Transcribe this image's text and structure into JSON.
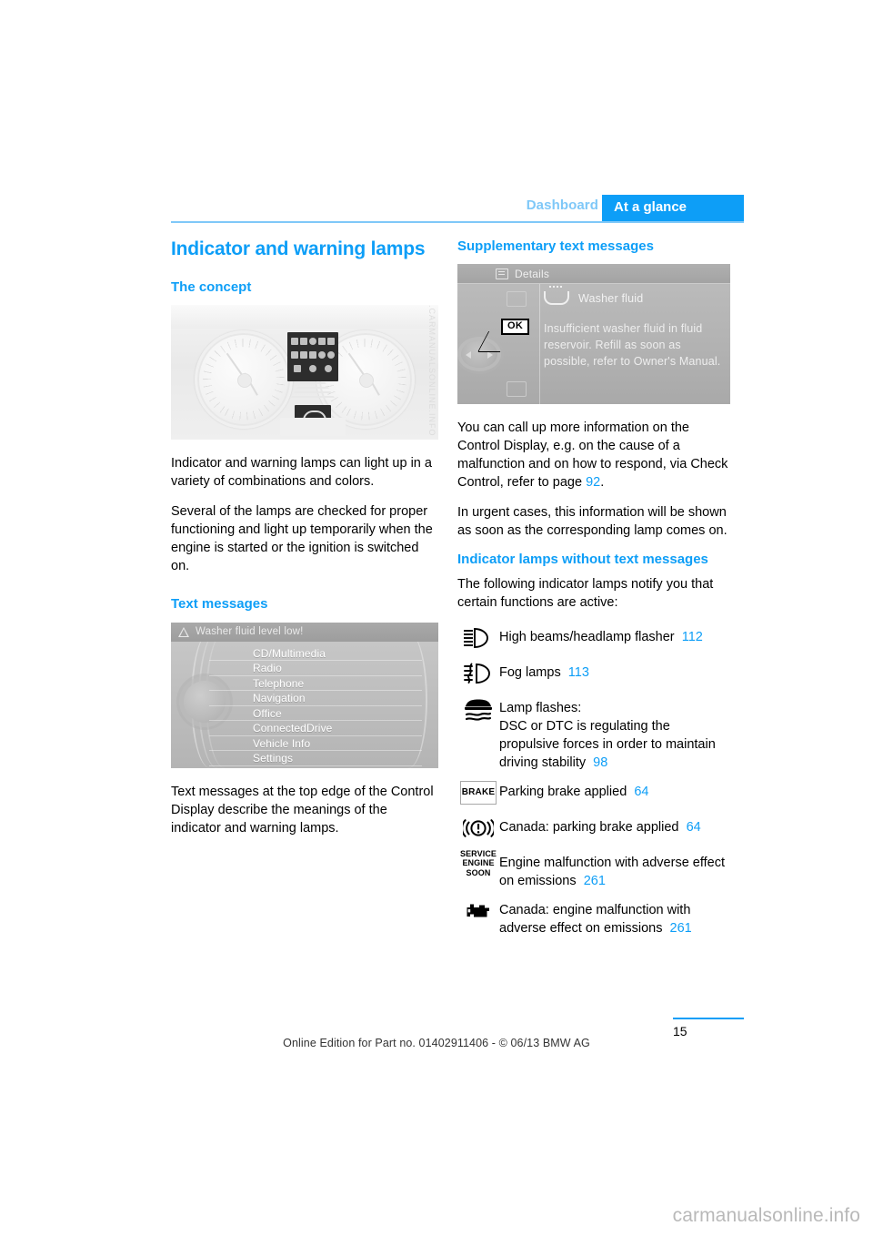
{
  "header": {
    "breadcrumb": "Dashboard",
    "tab": "At a glance",
    "accent_color": "#0d9ef7",
    "breadcrumb_color": "#7fc8f8"
  },
  "left_column": {
    "title": "Indicator and warning lamps",
    "concept": {
      "heading": "The concept",
      "figure": {
        "name": "instrument-cluster-photo",
        "watermark": "WWW.CARMANUALSONLINE.INFO"
      },
      "paragraphs": [
        "Indicator and warning lamps can light up in a variety of combinations and colors.",
        "Several of the lamps are checked for proper functioning and light up temporarily when the engine is started or the ignition is switched on."
      ]
    },
    "text_messages": {
      "heading": "Text messages",
      "figure": {
        "name": "idrive-main-menu",
        "status_bar": "Washer fluid level low!",
        "menu_items": [
          "CD/Multimedia",
          "Radio",
          "Telephone",
          "Navigation",
          "Office",
          "ConnectedDrive",
          "Vehicle Info",
          "Settings"
        ]
      },
      "paragraphs": [
        "Text messages at the top edge of the Control Display describe the meanings of the indicator and warning lamps."
      ]
    }
  },
  "right_column": {
    "supplementary": {
      "heading": "Supplementary text messages",
      "figure": {
        "name": "control-display-details",
        "title_bar": "Details",
        "ok_button": "OK",
        "item_title": "Washer fluid",
        "item_body": "Insufficient washer fluid in fluid reservoir. Refill as soon as possible, refer to Owner's Manual."
      },
      "paragraph_1_pre": "You can call up more information on the Control Display, e.g. on the cause of a malfunction and on how to respond, via Check Control, refer to page ",
      "paragraph_1_page": "92",
      "paragraph_1_post": ".",
      "paragraph_2": "In urgent cases, this information will be shown as soon as the corresponding lamp comes on."
    },
    "without_text": {
      "heading": "Indicator lamps without text messages",
      "intro": "The following indicator lamps notify you that certain functions are active:",
      "lamps": [
        {
          "icon": "high-beam-icon",
          "text": "High beams/headlamp flasher",
          "page": "112"
        },
        {
          "icon": "fog-lamp-icon",
          "text": "Fog lamps",
          "page": "113"
        },
        {
          "icon": "dsc-skid-icon",
          "text": "Lamp flashes:\nDSC or DTC is regulating the propulsive forces in order to maintain driving stability",
          "page": "98"
        },
        {
          "icon": "brake-text-icon",
          "icon_label": "BRAKE",
          "text": "Parking brake applied",
          "page": "64"
        },
        {
          "icon": "parking-brake-circle-icon",
          "text": "Canada: parking brake applied",
          "page": "64"
        },
        {
          "icon": "service-engine-soon-icon",
          "icon_label": "SERVICE\nENGINE\nSOON",
          "text": "Engine malfunction with adverse effect on emissions",
          "page": "261"
        },
        {
          "icon": "check-engine-icon",
          "text": "Canada: engine malfunction with adverse effect on emissions",
          "page": "261"
        }
      ]
    }
  },
  "footer": {
    "page_number": "15",
    "note": "Online Edition for Part no. 01402911406 - © 06/13 BMW AG",
    "site_watermark": "carmanualsonline.info"
  }
}
